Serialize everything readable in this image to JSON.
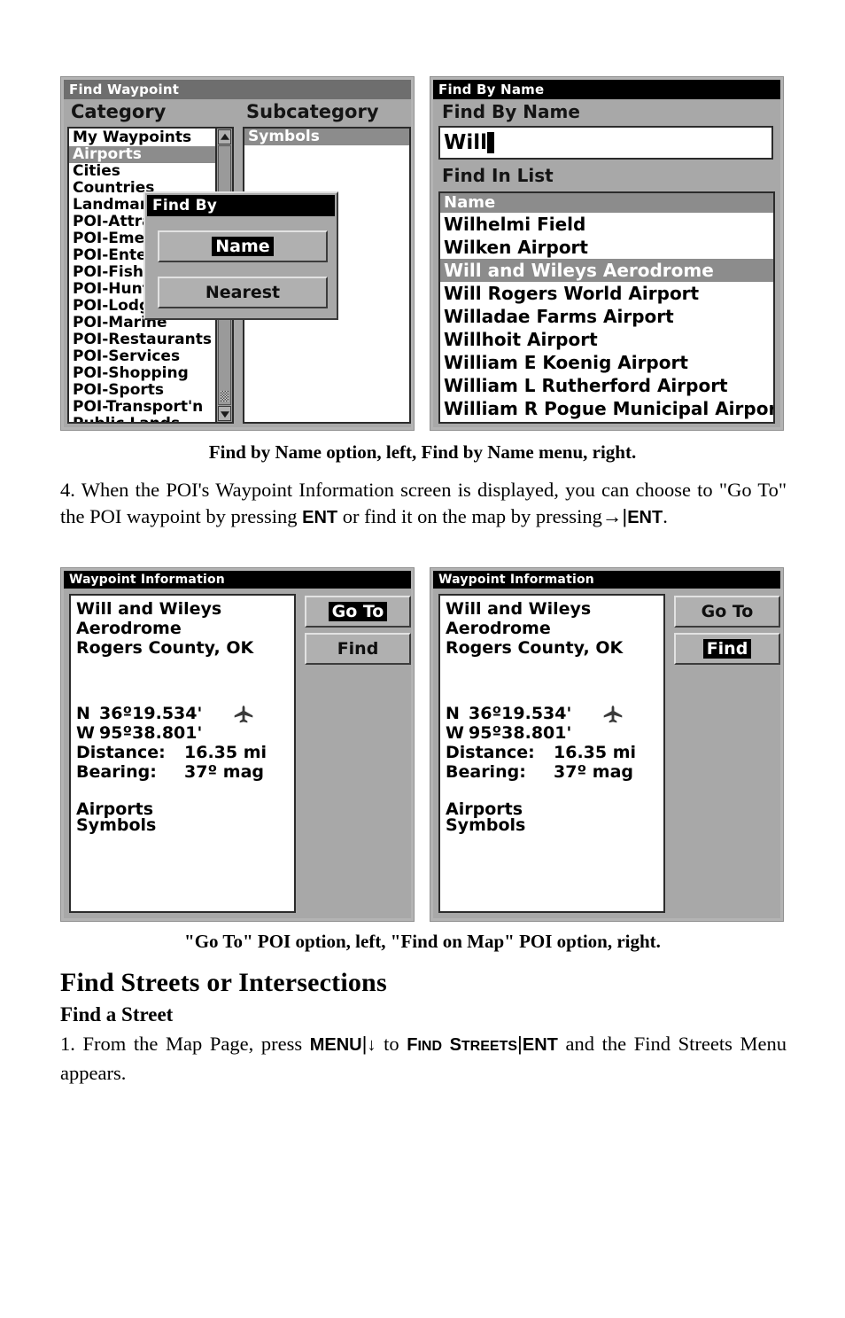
{
  "figure1": {
    "left_screen": {
      "title": "Find Waypoint",
      "category_header": "Category",
      "subcategory_header": "Subcategory",
      "categories": [
        "My Waypoints",
        "Airports",
        "Cities",
        "Countries",
        "Landmarks",
        "POI-Attractions",
        "POI-Emergency",
        "POI-Entertain",
        "POI-Fishing",
        "POI-Hunting",
        "POI-Lodging",
        "POI-Marine",
        "POI-Restaurants",
        "POI-Services",
        "POI-Shopping",
        "POI-Sports",
        "POI-Transport'n",
        "Public Lands"
      ],
      "selected_category": "Airports",
      "subcategories": [
        "Symbols"
      ],
      "selected_subcategory": "Symbols",
      "popup": {
        "title": "Find By",
        "buttons": [
          {
            "label": "Name",
            "highlighted": true
          },
          {
            "label": "Nearest",
            "highlighted": false
          }
        ]
      }
    },
    "right_screen": {
      "title": "Find By Name",
      "field_label": "Find By Name",
      "field_value": "Will",
      "list_label": "Find In List",
      "column_header": "Name",
      "results": [
        "Wilhelmi Field",
        "Wilken Airport",
        "Will and Wileys Aerodrome",
        "Will Rogers World Airport",
        "Willadae Farms Airport",
        "Willhoit Airport",
        "William E Koenig Airport",
        "William L Rutherford Airport",
        "William R Pogue Municipal Airport"
      ],
      "selected_result": "Will and Wileys Aerodrome"
    },
    "caption": "Find by Name option, left, Find by Name menu, right."
  },
  "body1": {
    "step_number": "4.",
    "text_a": "When the POI's Waypoint Information screen is displayed, you can choose to \"Go To\" the POI waypoint by pressing ",
    "key_ent_1": "ENT",
    "text_b": " or find it on the map by pressing",
    "arrow": "→",
    "pipe": "|",
    "key_ent_2": "ENT",
    "period": "."
  },
  "figure2": {
    "left_screen": {
      "title": "Waypoint Information",
      "name_line1": "Will and Wileys",
      "name_line2": "Aerodrome",
      "location": "Rogers County, OK",
      "lat_prefix": "N",
      "lat_value": "36º19.534'",
      "lon_prefix": "W",
      "lon_value": "95º38.801'",
      "distance_label": "Distance:",
      "distance_value": "16.35 mi",
      "bearing_label": "Bearing:",
      "bearing_value": "37º mag",
      "category": "Airports",
      "subcategory": "Symbols",
      "icon": "airplane-icon",
      "buttons": [
        {
          "label": "Go To",
          "highlighted": true
        },
        {
          "label": "Find",
          "highlighted": false
        }
      ]
    },
    "right_screen": {
      "title": "Waypoint Information",
      "name_line1": "Will and Wileys",
      "name_line2": "Aerodrome",
      "location": "Rogers County, OK",
      "lat_prefix": "N",
      "lat_value": "36º19.534'",
      "lon_prefix": "W",
      "lon_value": "95º38.801'",
      "distance_label": "Distance:",
      "distance_value": "16.35 mi",
      "bearing_label": "Bearing:",
      "bearing_value": "37º mag",
      "category": "Airports",
      "subcategory": "Symbols",
      "icon": "airplane-icon",
      "buttons": [
        {
          "label": "Go To",
          "highlighted": false
        },
        {
          "label": "Find",
          "highlighted": true
        }
      ]
    },
    "caption": "\"Go To\" POI option, left, \"Find on Map\" POI option, right."
  },
  "section": {
    "heading": "Find Streets or Intersections",
    "subheading": "Find a Street"
  },
  "body2": {
    "step_number": "1.",
    "text_a": "From the Map Page, press ",
    "key_menu": "MENU",
    "pipe1": "|",
    "arrow_down": "↓",
    "text_b": " to ",
    "sc_find_f": "F",
    "sc_find_ind": "IND",
    "sc_streets_s": "S",
    "sc_streets_treets": "TREETS",
    "pipe2": "|",
    "key_ent": "ENT",
    "text_c": " and the Find Streets Menu appears."
  },
  "colors": {
    "screen_bg": "#a8a8a8",
    "titlebar_gray": "#6e6e6e",
    "titlebar_black": "#000000",
    "selection_gray": "#8c8c8c",
    "list_white": "#ffffff",
    "button_face": "#b0b0b0"
  }
}
